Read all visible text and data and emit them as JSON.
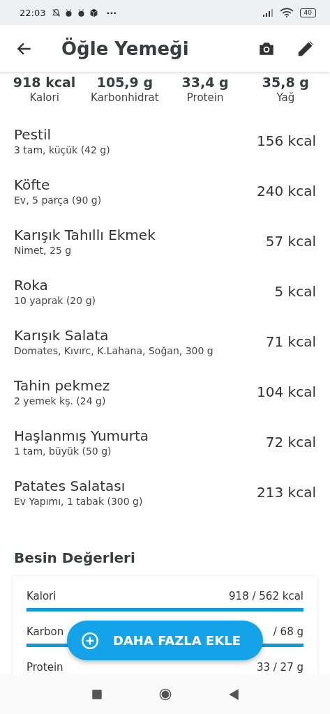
{
  "status_bar": {
    "time": "22:03",
    "more": "···",
    "battery": "40"
  },
  "app_bar": {
    "title": "Öğle Yemeği"
  },
  "summary": [
    {
      "value": "918 kcal",
      "label": "Kalori"
    },
    {
      "value": "105,9 g",
      "label": "Karbonhidrat"
    },
    {
      "value": "33,4 g",
      "label": "Protein"
    },
    {
      "value": "35,8 g",
      "label": "Yağ"
    }
  ],
  "foods": [
    {
      "name": "Pestil",
      "detail": "3 tam, küçük (42 g)",
      "kcal": "156 kcal"
    },
    {
      "name": "Köfte",
      "detail": "Ev, 5 parça (90 g)",
      "kcal": "240 kcal"
    },
    {
      "name": "Karışık Tahıllı Ekmek",
      "detail": "Nimet, 25 g",
      "kcal": "57 kcal"
    },
    {
      "name": "Roka",
      "detail": "10 yaprak (20 g)",
      "kcal": "5 kcal"
    },
    {
      "name": "Karışık Salata",
      "detail": "Domates, Kıvırc, K.Lahana, Soğan, 300 g",
      "kcal": "71 kcal"
    },
    {
      "name": "Tahin pekmez",
      "detail": "2 yemek kş. (24 g)",
      "kcal": "104 kcal"
    },
    {
      "name": "Haşlanmış Yumurta",
      "detail": "1 tam, büyük (50 g)",
      "kcal": "72 kcal"
    },
    {
      "name": "Patates Salatası",
      "detail": "Ev Yapımı, 1 tabak (300 g)",
      "kcal": "213 kcal"
    }
  ],
  "nutrients": {
    "title": "Besin Değerleri",
    "rows": [
      {
        "label": "Kalori",
        "value": "918 / 562 kcal",
        "level": 1
      },
      {
        "label": "Karbon",
        "value": "/ 68 g",
        "level": 1
      },
      {
        "label": "Protein",
        "value": "33 / 27 g"
      }
    ]
  },
  "fab": {
    "label": "DAHA FAZLA EKLE"
  }
}
